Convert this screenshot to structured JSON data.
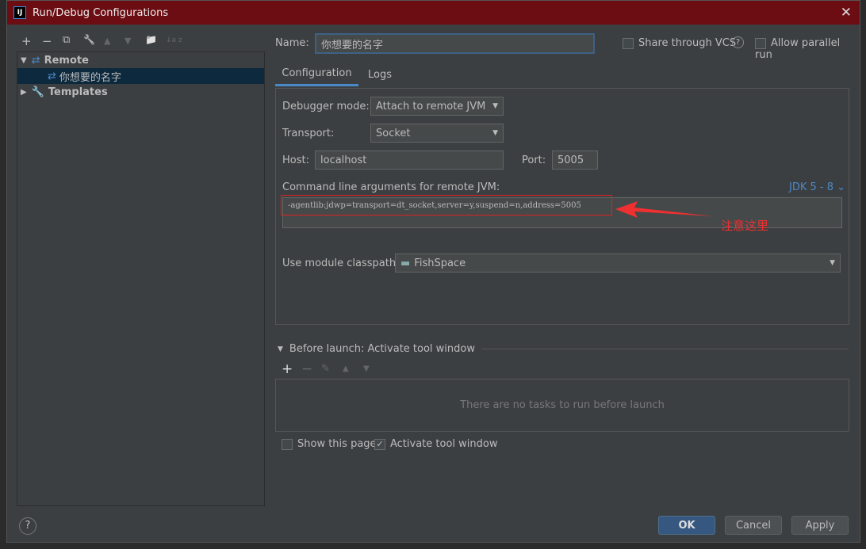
{
  "window": {
    "title": "Run/Debug Configurations",
    "logo": "IJ"
  },
  "toolbar": {
    "add": "+",
    "remove": "−",
    "copy": "⧉",
    "edit": "🔧",
    "up": "▲",
    "down": "▼",
    "folder": "📁",
    "sort": "↓a z"
  },
  "tree": {
    "remote": "Remote",
    "config": "你想要的名字",
    "templates": "Templates"
  },
  "name_label": "Name:",
  "name_value": "你想要的名字",
  "share_vcs": "Share through VCS",
  "help_q": "?",
  "allow_parallel": "Allow parallel run",
  "tabs": [
    "Configuration",
    "Logs"
  ],
  "debugger_mode_label": "Debugger mode:",
  "debugger_mode": "Attach to remote JVM",
  "transport_label": "Transport:",
  "transport": "Socket",
  "host_label": "Host:",
  "host": "localhost",
  "port_label": "Port:",
  "port": "5005",
  "cmd_label": "Command line arguments for remote JVM:",
  "jdk": "JDK 5 - 8",
  "cmd_value": "-agentlib:jdwp=transport=dt_socket,server=y,suspend=n,address=5005",
  "annotation": "注意这里",
  "module_label": "Use module classpath:",
  "module": "FishSpace",
  "before_launch": "Before launch: Activate tool window",
  "no_tasks": "There are no tasks to run before launch",
  "show_page": "Show this page",
  "activate_tool": "Activate tool window",
  "buttons": {
    "ok": "OK",
    "cancel": "Cancel",
    "apply": "Apply",
    "help": "?"
  }
}
